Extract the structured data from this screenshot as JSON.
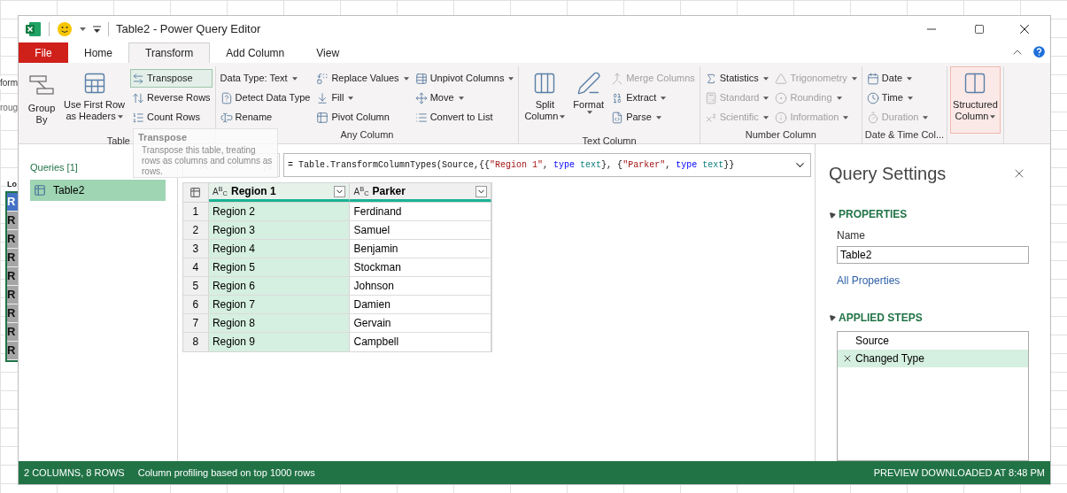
{
  "excel_background": {
    "texts": [
      "form",
      "roug",
      "Lo"
    ],
    "cells": [
      {
        "label": "R",
        "selected": true
      },
      {
        "label": "R",
        "selected": false
      },
      {
        "label": "R",
        "selected": false
      },
      {
        "label": "R",
        "selected": false
      },
      {
        "label": "R",
        "selected": false
      },
      {
        "label": "R",
        "selected": false
      },
      {
        "label": "R",
        "selected": false
      },
      {
        "label": "R",
        "selected": false
      },
      {
        "label": "R",
        "selected": false
      }
    ]
  },
  "window": {
    "title": "Table2 - Power Query Editor"
  },
  "tabs": [
    {
      "label": "File",
      "kind": "file",
      "selected": false
    },
    {
      "label": "Home",
      "kind": "tab",
      "selected": false
    },
    {
      "label": "Transform",
      "kind": "tab",
      "selected": true
    },
    {
      "label": "Add Column",
      "kind": "tab",
      "selected": false
    },
    {
      "label": "View",
      "kind": "tab",
      "selected": false
    }
  ],
  "ribbon": [
    {
      "label": "Table",
      "columns": [
        {
          "kind": "large",
          "items": [
            {
              "lines": [
                "Group",
                "By"
              ],
              "dropdown": false,
              "disabled": false,
              "highlighted": false
            }
          ]
        },
        {
          "kind": "large",
          "items": [
            {
              "lines": [
                "Use First Row",
                "as Headers"
              ],
              "dropdown": true,
              "disabled": false,
              "highlighted": false
            }
          ]
        },
        {
          "kind": "stack",
          "items": [
            {
              "lines": [
                "Transpose"
              ],
              "dropdown": false,
              "disabled": false,
              "highlighted": true
            },
            {
              "lines": [
                "Reverse Rows"
              ],
              "dropdown": false,
              "disabled": false,
              "highlighted": false
            },
            {
              "lines": [
                "Count Rows"
              ],
              "dropdown": false,
              "disabled": false,
              "highlighted": false
            }
          ]
        }
      ]
    },
    {
      "label": "Any Column",
      "columns": [
        {
          "kind": "stack",
          "items": [
            {
              "lines": [
                "Data Type: Text"
              ],
              "dropdown": true,
              "disabled": false,
              "highlighted": false
            },
            {
              "lines": [
                "Detect Data Type"
              ],
              "dropdown": false,
              "disabled": false,
              "highlighted": false
            },
            {
              "lines": [
                "Rename"
              ],
              "dropdown": false,
              "disabled": false,
              "highlighted": false
            }
          ]
        },
        {
          "kind": "stack",
          "items": [
            {
              "lines": [
                "Replace Values"
              ],
              "dropdown": true,
              "disabled": false,
              "highlighted": false
            },
            {
              "lines": [
                "Fill"
              ],
              "dropdown": true,
              "disabled": false,
              "highlighted": false
            },
            {
              "lines": [
                "Pivot Column"
              ],
              "dropdown": false,
              "disabled": false,
              "highlighted": false
            }
          ]
        },
        {
          "kind": "stack",
          "items": [
            {
              "lines": [
                "Unpivot Columns"
              ],
              "dropdown": true,
              "disabled": false,
              "highlighted": false
            },
            {
              "lines": [
                "Move"
              ],
              "dropdown": true,
              "disabled": false,
              "highlighted": false
            },
            {
              "lines": [
                "Convert to List"
              ],
              "dropdown": false,
              "disabled": false,
              "highlighted": false
            }
          ]
        }
      ]
    },
    {
      "label": "Text Column",
      "columns": [
        {
          "kind": "large",
          "items": [
            {
              "lines": [
                "Split",
                "Column"
              ],
              "dropdown": true,
              "disabled": false,
              "highlighted": false
            }
          ]
        },
        {
          "kind": "large",
          "items": [
            {
              "lines": [
                "Format"
              ],
              "dropdown": true,
              "disabled": false,
              "highlighted": false
            }
          ]
        },
        {
          "kind": "stack",
          "items": [
            {
              "lines": [
                "Merge Columns"
              ],
              "dropdown": false,
              "disabled": true,
              "highlighted": false
            },
            {
              "lines": [
                "Extract"
              ],
              "dropdown": true,
              "disabled": false,
              "highlighted": false
            },
            {
              "lines": [
                "Parse"
              ],
              "dropdown": true,
              "disabled": false,
              "highlighted": false
            }
          ]
        }
      ]
    },
    {
      "label": "Number Column",
      "columns": [
        {
          "kind": "stack",
          "items": [
            {
              "lines": [
                "Statistics"
              ],
              "dropdown": true,
              "disabled": false,
              "highlighted": false
            },
            {
              "lines": [
                "Standard"
              ],
              "dropdown": true,
              "disabled": true,
              "highlighted": false
            },
            {
              "lines": [
                "Scientific"
              ],
              "dropdown": true,
              "disabled": true,
              "highlighted": false
            }
          ]
        },
        {
          "kind": "stack",
          "items": [
            {
              "lines": [
                "Trigonometry"
              ],
              "dropdown": true,
              "disabled": true,
              "highlighted": false
            },
            {
              "lines": [
                "Rounding"
              ],
              "dropdown": true,
              "disabled": true,
              "highlighted": false
            },
            {
              "lines": [
                "Information"
              ],
              "dropdown": true,
              "disabled": true,
              "highlighted": false
            }
          ]
        }
      ]
    },
    {
      "label": "Date & Time Col...",
      "columns": [
        {
          "kind": "stack",
          "items": [
            {
              "lines": [
                "Date"
              ],
              "dropdown": true,
              "disabled": false,
              "highlighted": false
            },
            {
              "lines": [
                "Time"
              ],
              "dropdown": true,
              "disabled": false,
              "highlighted": false
            },
            {
              "lines": [
                "Duration"
              ],
              "dropdown": true,
              "disabled": true,
              "highlighted": false
            }
          ]
        }
      ]
    },
    {
      "columns": [
        {
          "kind": "large",
          "items": [
            {
              "lines": [
                "Structured",
                "Column"
              ],
              "dropdown": true,
              "disabled": false,
              "highlighted": true
            }
          ]
        }
      ]
    }
  ],
  "tooltip": {
    "title": "Transpose",
    "text": "Transpose this table, treating rows as columns and columns as rows."
  },
  "queries": {
    "header": "Queries [1]",
    "items": [
      {
        "label": "Table2",
        "selected": true
      }
    ]
  },
  "formula": [
    {
      "kind": "plain",
      "text": "= Table.TransformColumnTypes(Source,{{"
    },
    {
      "kind": "string",
      "text": "\"Region 1\""
    },
    {
      "kind": "plain",
      "text": ", "
    },
    {
      "kind": "keyword",
      "text": "type"
    },
    {
      "kind": "type",
      "text": " text"
    },
    {
      "kind": "plain",
      "text": "}, {"
    },
    {
      "kind": "string",
      "text": "\"Parker\""
    },
    {
      "kind": "plain",
      "text": ", "
    },
    {
      "kind": "keyword",
      "text": "type"
    },
    {
      "kind": "type",
      "text": " text"
    },
    {
      "kind": "plain",
      "text": "}}"
    }
  ],
  "table": {
    "columns": [
      {
        "type": "A$^{B}$$_{C}$",
        "name": "Region 1",
        "selected": true
      },
      {
        "type": "A$^{B}$$_{C}$",
        "name": "Parker",
        "selected": false
      }
    ],
    "rows": [
      {
        "index": "1",
        "cells": [
          "Region 2",
          "Ferdinand"
        ]
      },
      {
        "index": "2",
        "cells": [
          "Region 3",
          "Samuel"
        ]
      },
      {
        "index": "3",
        "cells": [
          "Region 4",
          "Benjamin"
        ]
      },
      {
        "index": "4",
        "cells": [
          "Region 5",
          "Stockman"
        ]
      },
      {
        "index": "5",
        "cells": [
          "Region 6",
          "Johnson"
        ]
      },
      {
        "index": "6",
        "cells": [
          "Region 7",
          "Damien"
        ]
      },
      {
        "index": "7",
        "cells": [
          "Region 8",
          "Gervain"
        ]
      },
      {
        "index": "8",
        "cells": [
          "Region 9",
          "Campbell"
        ]
      }
    ]
  },
  "settings": {
    "title": "Query Settings",
    "properties_title": "PROPERTIES",
    "name_label": "Name",
    "name_value": "Table2",
    "all_properties": "All Properties",
    "steps_title": "APPLIED STEPS",
    "steps": [
      {
        "label": "Source",
        "selected": false
      },
      {
        "label": "Changed Type",
        "selected": true
      }
    ]
  },
  "status_bar": {
    "left": [
      "2 COLUMNS, 8 ROWS",
      "Column profiling based on top 1000 rows"
    ],
    "right": "PREVIEW DOWNLOADED AT 8:48 PM"
  }
}
